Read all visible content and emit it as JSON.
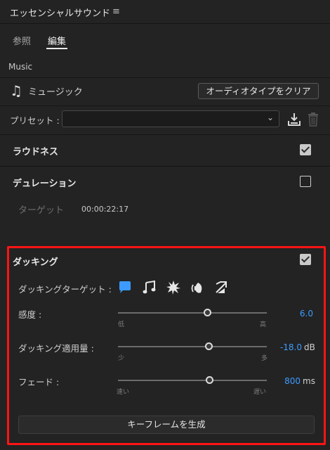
{
  "header": {
    "title": "エッセンシャルサウンド",
    "menu_glyph": "≡"
  },
  "tabs": [
    {
      "label": "参照"
    },
    {
      "label": "編集"
    }
  ],
  "active_tab": "編集",
  "type_label": "Music",
  "music": {
    "icon": "music-note-icon",
    "label": "ミュージック",
    "clear_button": "オーディオタイプをクリア"
  },
  "preset": {
    "label": "プリセット :",
    "value": "",
    "save_icon": "save-preset-icon",
    "delete_icon": "trash-icon"
  },
  "loudness": {
    "label": "ラウドネス",
    "checked": true
  },
  "duration": {
    "label": "デュレーション",
    "checked": false,
    "target_label": "ターゲット",
    "target_time": "00:00:22:17"
  },
  "ducking": {
    "label": "ダッキング",
    "checked": true,
    "targets_label": "ダッキングターゲット :",
    "target_icons": [
      "dialogue-icon",
      "music-icon",
      "sfx-icon",
      "ambience-icon",
      "unassigned-icon"
    ],
    "selected_target": "dialogue-icon",
    "sensitivity": {
      "label": "感度 :",
      "min_label": "低",
      "max_label": "高",
      "value": "6.0",
      "unit": "",
      "fraction": 0.6
    },
    "amount": {
      "label": "ダッキング適用量 :",
      "min_label": "少",
      "max_label": "多",
      "value": "-18.0",
      "unit": "dB",
      "fraction": 0.62
    },
    "fade": {
      "label": "フェード :",
      "min_label": "速い",
      "max_label": "遅い",
      "value": "800",
      "unit": "ms",
      "fraction": 0.62
    },
    "generate_button": "キーフレームを生成"
  },
  "colors": {
    "accent": "#3d9bff",
    "highlight": "#ff1414",
    "background": "#232323"
  }
}
